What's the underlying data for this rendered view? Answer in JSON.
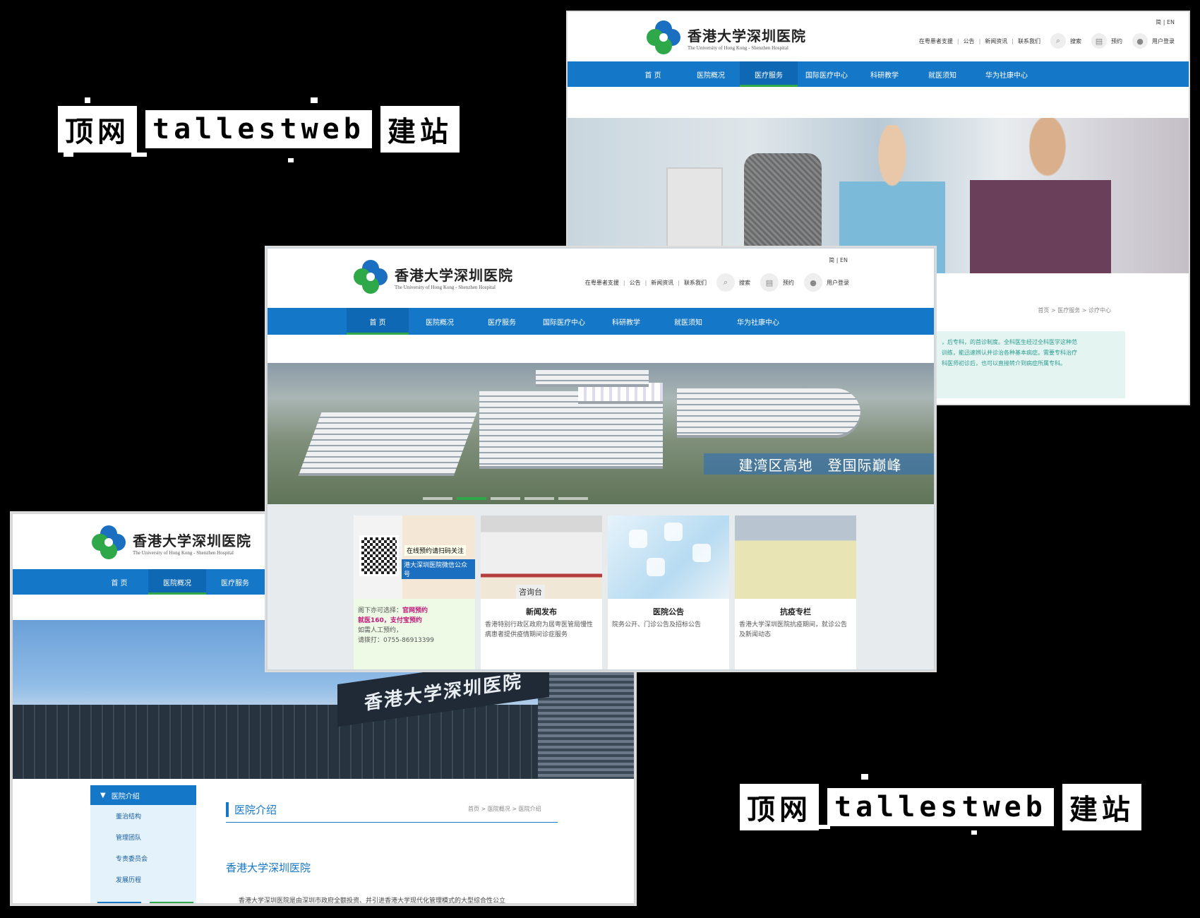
{
  "watermark": {
    "brand1": "顶网",
    "brand2": "tallestweb",
    "brand3": "建站"
  },
  "site": {
    "name_cn": "香港大学深圳医院",
    "name_en": "The University of Hong Kong - Shenzhen Hospital",
    "lang": "简 | EN",
    "toplinks": [
      "在粤患者支援",
      "公告",
      "新闻资讯",
      "联系我们"
    ],
    "tools": {
      "search": "搜索",
      "booking": "预约",
      "login": "用户登录"
    },
    "nav": [
      "首 页",
      "医院概况",
      "医疗服务",
      "国际医疗中心",
      "科研教学",
      "就医须知",
      "华为社康中心"
    ]
  },
  "winA": {
    "breadcrumb": "首页 > 医疗服务 > 诊疗中心",
    "note": [
      "，后专科，的首诊制度。全科医生经过全科医学这种范",
      "训练，能迅速辨认并诊治各种基本病症。需要专科治疗",
      "科医师初诊后，也可以直接转介到病症所属专科。"
    ]
  },
  "winB": {
    "slogan": "建湾区高地　登国际巅峰",
    "cards": [
      {
        "banner1": "在线预约请扫码关注",
        "banner2": "港大深圳医院微信公众号",
        "line1_a": "阁下亦可选择：",
        "line1_b": "官网预约",
        "line2_a": "就医160",
        "line2_sep": "，",
        "line2_b": "支付宝预约",
        "line3": "如需人工预约，",
        "line4": "请拨打：0755-86913399"
      },
      {
        "title": "新闻发布",
        "desk": "咨询台",
        "text": "香港特别行政区政府为居粤医管局慢性病患者提供疫情期间诊症服务"
      },
      {
        "title": "医院公告",
        "text": "院务公开、门诊公告及招标公告"
      },
      {
        "title": "抗疫专栏",
        "text": "香港大学深圳医院抗疫期间，就诊公告及新闻动态"
      }
    ]
  },
  "winC": {
    "sign": "香港大学深圳医院",
    "side_head": "医院介绍",
    "side_items": [
      "董治结构",
      "管理团队",
      "专责委员会",
      "发展历程"
    ],
    "section_title": "医院介绍",
    "breadcrumb": "首页 > 医院概况 > 医院介绍",
    "heading": "香港大学深圳医院",
    "para": "香港大学深圳医院是由深圳市政府全额投资、并引进香港大学现代化管理模式的大型综合性公立"
  }
}
